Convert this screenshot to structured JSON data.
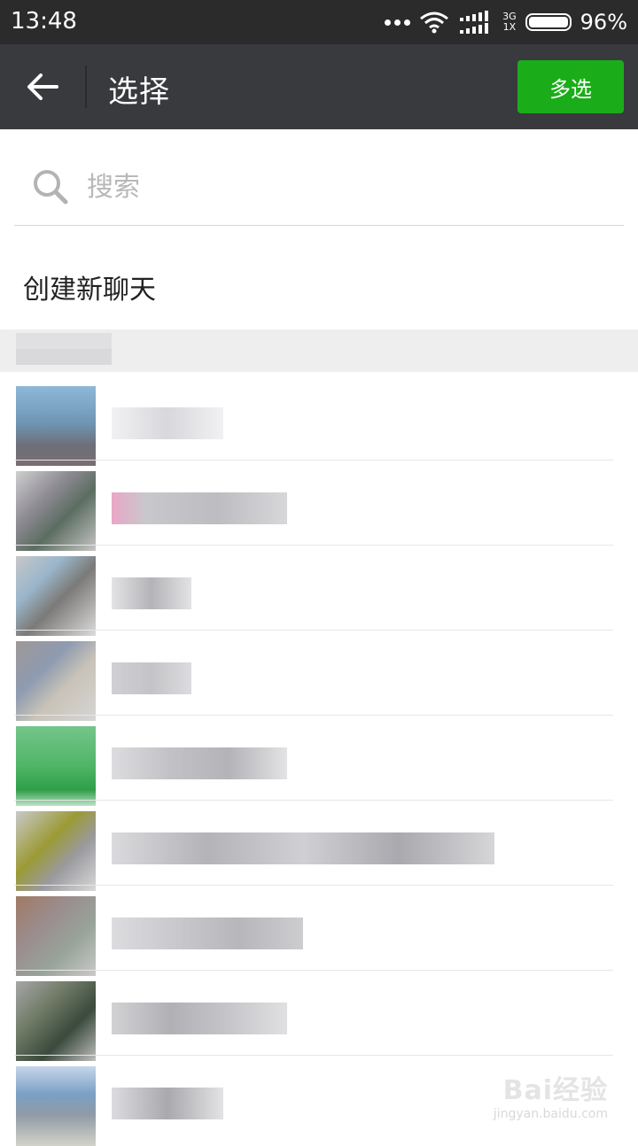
{
  "status_bar": {
    "time": "13:48",
    "network_top": "3G",
    "network_bottom": "1X",
    "battery_percent": "96%"
  },
  "header": {
    "title": "选择",
    "multi_select_label": "多选",
    "back_icon": "arrow-left-icon"
  },
  "search": {
    "placeholder": "搜索",
    "value": ""
  },
  "create_new_chat": "创建新聊天",
  "watermark": {
    "brand": "Bai经验",
    "url": "jingyan.baidu.com"
  },
  "colors": {
    "accent_green": "#1aad19",
    "header_bg": "#393a3e",
    "status_bg": "#2b2b2b"
  }
}
